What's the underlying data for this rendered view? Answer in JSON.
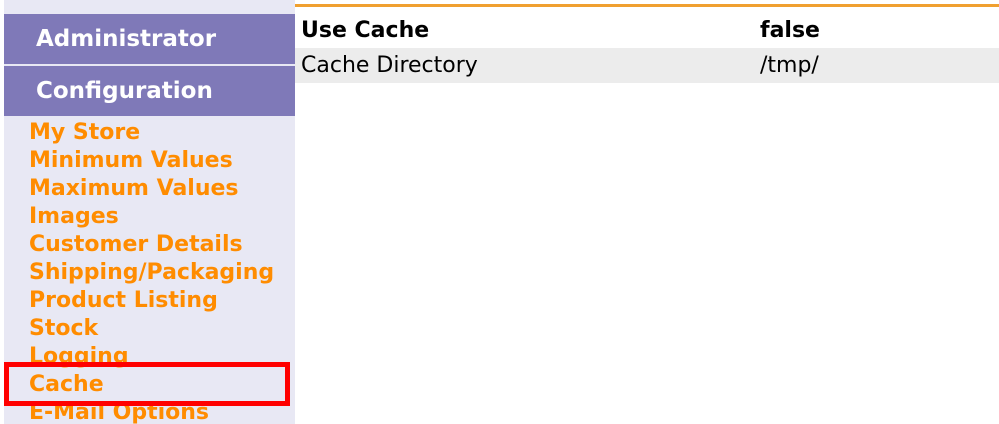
{
  "sidebar": {
    "header_admin": "Administrator",
    "header_config": "Configuration",
    "items": [
      {
        "label": "My Store"
      },
      {
        "label": "Minimum Values"
      },
      {
        "label": "Maximum Values"
      },
      {
        "label": "Images"
      },
      {
        "label": "Customer Details"
      },
      {
        "label": "Shipping/Packaging"
      },
      {
        "label": "Product Listing"
      },
      {
        "label": "Stock"
      },
      {
        "label": "Logging"
      },
      {
        "label": "Cache"
      },
      {
        "label": "E-Mail Options"
      }
    ],
    "selected_item": "Cache"
  },
  "config_table": {
    "header": {
      "key": "Use Cache",
      "value": "false"
    },
    "rows": [
      {
        "key": "Cache Directory",
        "value": "/tmp/"
      }
    ]
  },
  "colors": {
    "sidebar_bg": "#e8e8f4",
    "header_bg": "#7f79b8",
    "link_orange": "#ff8c00",
    "highlight_red": "#ff0000",
    "accent_line": "#f0a030"
  }
}
